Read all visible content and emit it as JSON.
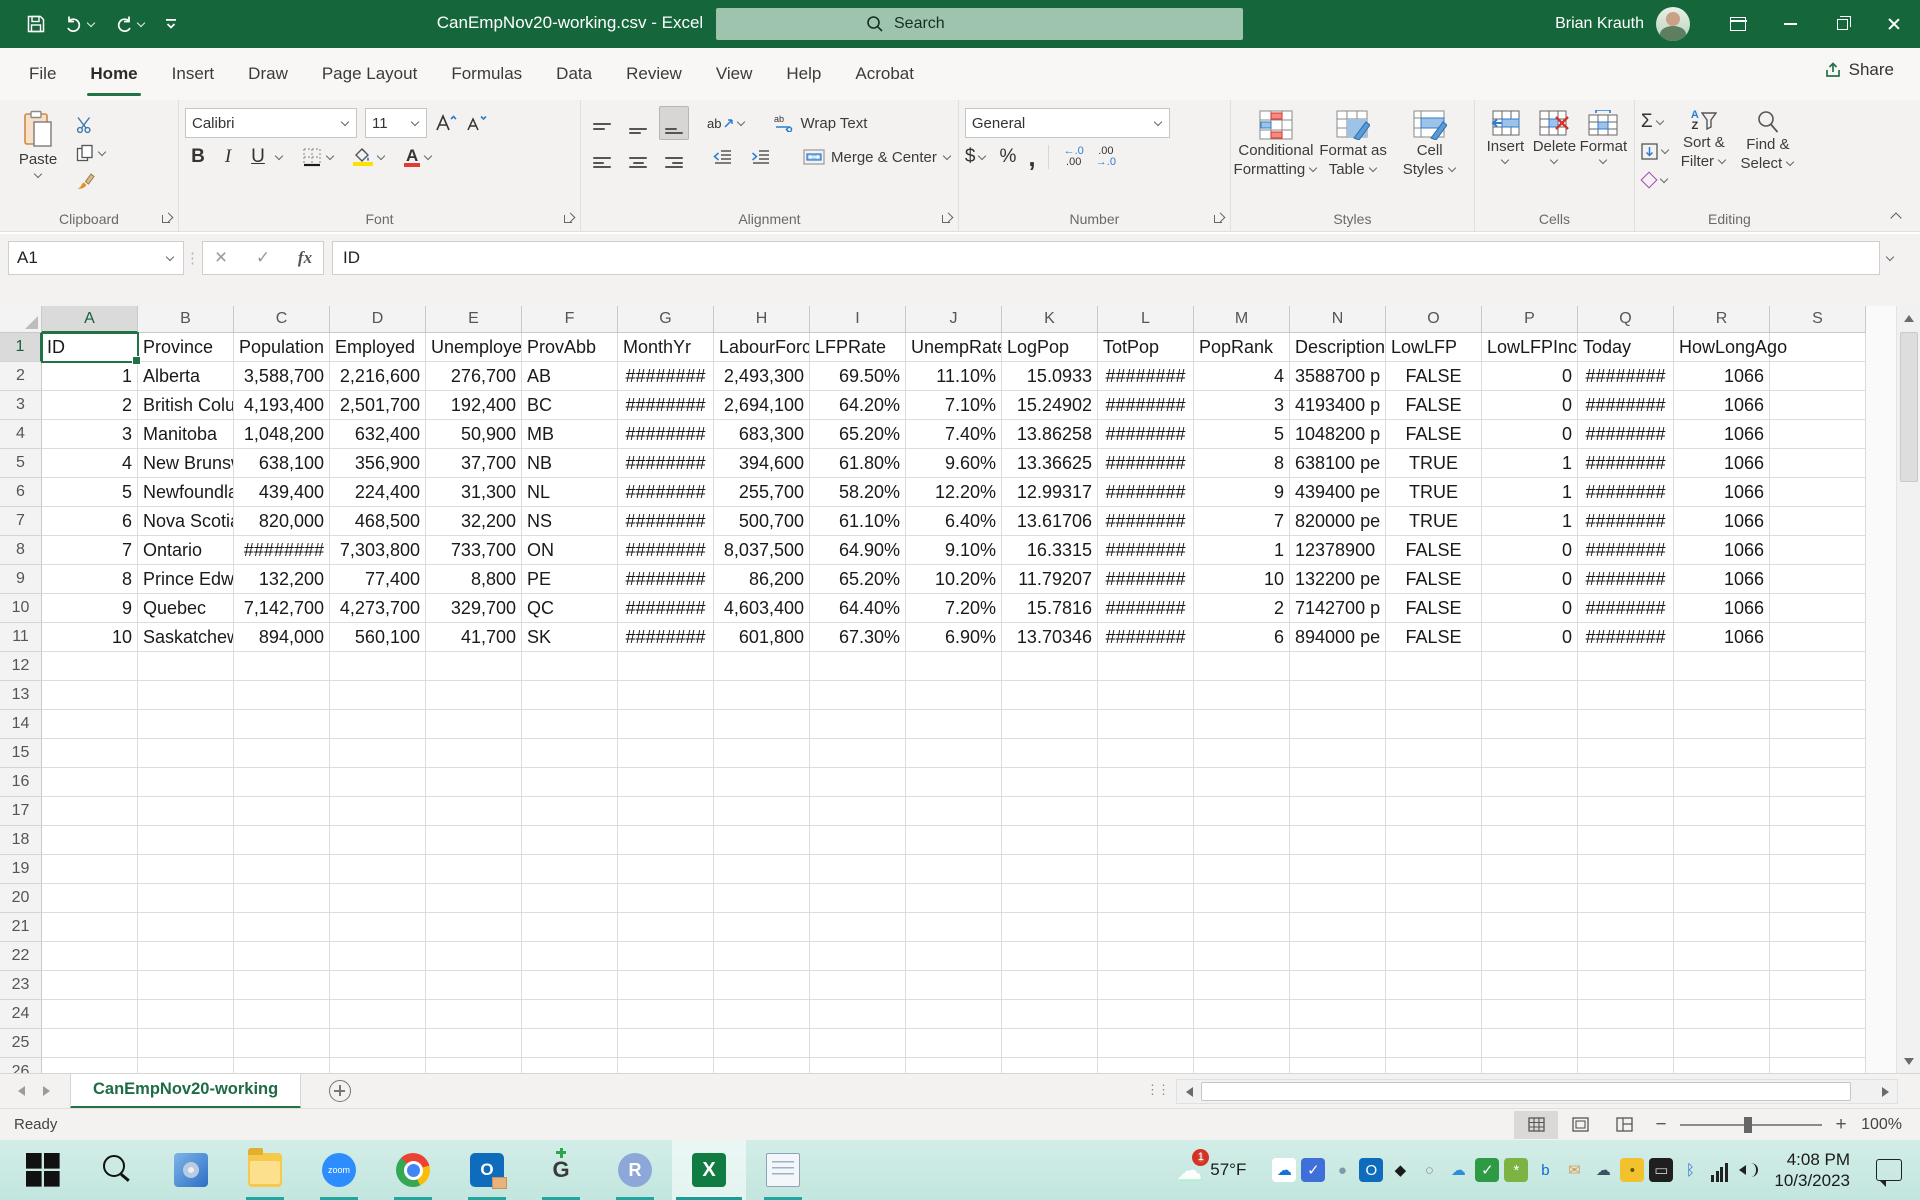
{
  "colors": {
    "excel_green": "#217346",
    "title_green": "#16663C",
    "taskbar_teal": "#20A8A0"
  },
  "titlebar": {
    "title": "CanEmpNov20-working.csv  -  Excel",
    "search_placeholder": "Search",
    "user_name": "Brian Krauth"
  },
  "ribbon": {
    "tabs": [
      "File",
      "Home",
      "Insert",
      "Draw",
      "Page Layout",
      "Formulas",
      "Data",
      "Review",
      "View",
      "Help",
      "Acrobat"
    ],
    "active_tab": "Home",
    "share_label": "Share",
    "groups": {
      "clipboard": {
        "label": "Clipboard",
        "paste": "Paste"
      },
      "font": {
        "label": "Font",
        "font_name": "Calibri",
        "font_size": "11"
      },
      "alignment": {
        "label": "Alignment",
        "wrap_text": "Wrap Text",
        "merge_center": "Merge & Center"
      },
      "number": {
        "label": "Number",
        "format": "General"
      },
      "styles": {
        "label": "Styles",
        "conditional_1": "Conditional",
        "conditional_2": "Formatting",
        "format_table_1": "Format as",
        "format_table_2": "Table",
        "cell_styles_1": "Cell",
        "cell_styles_2": "Styles"
      },
      "cells": {
        "label": "Cells",
        "insert": "Insert",
        "delete": "Delete",
        "format": "Format"
      },
      "editing": {
        "label": "Editing",
        "sort_1": "Sort &",
        "sort_2": "Filter",
        "find_1": "Find &",
        "find_2": "Select"
      }
    }
  },
  "icons": {
    "bold": "B",
    "italic": "I",
    "underline": "U",
    "font_color": "A",
    "fill_color": "A",
    "autosum": "Σ",
    "currency": "$",
    "percent": "%",
    "comma": ",",
    "orientation": "ab",
    "wrap_ab": "ab",
    "dec_inc_top": "←.0",
    "dec_inc_bot": ".00",
    "dec_dec_top": ".00",
    "dec_dec_bot": "→.0",
    "fx": "fx",
    "cancel": "×",
    "enter": "✓",
    "az_a": "A",
    "az_z": "Z"
  },
  "formula_bar": {
    "name_box": "A1",
    "content": "ID"
  },
  "sheet": {
    "columns": [
      "A",
      "B",
      "C",
      "D",
      "E",
      "F",
      "G",
      "H",
      "I",
      "J",
      "K",
      "L",
      "M",
      "N",
      "O",
      "P",
      "Q",
      "R",
      "S"
    ],
    "selected_cell": "A1",
    "visible_rows": 26,
    "col_align": [
      "right",
      "left",
      "right",
      "right",
      "right",
      "left",
      "center",
      "right",
      "right",
      "right",
      "right",
      "center",
      "right",
      "left",
      "center",
      "right",
      "center",
      "right",
      "left"
    ],
    "header_row": [
      "ID",
      "Province",
      "Population",
      "Employed",
      "Unemployed",
      "ProvAbb",
      "MonthYr",
      "LabourForce",
      "LFPRate",
      "UnempRate",
      "LogPop",
      "TotPop",
      "PopRank",
      "Description",
      "LowLFP",
      "LowLFPInc",
      "Today",
      "HowLongAgo",
      ""
    ],
    "rows": [
      [
        "1",
        "Alberta",
        "3,588,700",
        "2,216,600",
        "276,700",
        "AB",
        "########",
        "2,493,300",
        "69.50%",
        "11.10%",
        "15.0933",
        "########",
        "4",
        "3588700 p",
        "FALSE",
        "0",
        "########",
        "1066",
        ""
      ],
      [
        "2",
        "British Columbia",
        "4,193,400",
        "2,501,700",
        "192,400",
        "BC",
        "########",
        "2,694,100",
        "64.20%",
        "7.10%",
        "15.24902",
        "########",
        "3",
        "4193400 p",
        "FALSE",
        "0",
        "########",
        "1066",
        ""
      ],
      [
        "3",
        "Manitoba",
        "1,048,200",
        "632,400",
        "50,900",
        "MB",
        "########",
        "683,300",
        "65.20%",
        "7.40%",
        "13.86258",
        "########",
        "5",
        "1048200 p",
        "FALSE",
        "0",
        "########",
        "1066",
        ""
      ],
      [
        "4",
        "New Brunswick",
        "638,100",
        "356,900",
        "37,700",
        "NB",
        "########",
        "394,600",
        "61.80%",
        "9.60%",
        "13.36625",
        "########",
        "8",
        "638100 pe",
        "TRUE",
        "1",
        "########",
        "1066",
        ""
      ],
      [
        "5",
        "Newfoundland",
        "439,400",
        "224,400",
        "31,300",
        "NL",
        "########",
        "255,700",
        "58.20%",
        "12.20%",
        "12.99317",
        "########",
        "9",
        "439400 pe",
        "TRUE",
        "1",
        "########",
        "1066",
        ""
      ],
      [
        "6",
        "Nova Scotia",
        "820,000",
        "468,500",
        "32,200",
        "NS",
        "########",
        "500,700",
        "61.10%",
        "6.40%",
        "13.61706",
        "########",
        "7",
        "820000 pe",
        "TRUE",
        "1",
        "########",
        "1066",
        ""
      ],
      [
        "7",
        "Ontario",
        "########",
        "7,303,800",
        "733,700",
        "ON",
        "########",
        "8,037,500",
        "64.90%",
        "9.10%",
        "16.3315",
        "########",
        "1",
        "12378900",
        "FALSE",
        "0",
        "########",
        "1066",
        ""
      ],
      [
        "8",
        "Prince Edward Island",
        "132,200",
        "77,400",
        "8,800",
        "PE",
        "########",
        "86,200",
        "65.20%",
        "10.20%",
        "11.79207",
        "########",
        "10",
        "132200 pe",
        "FALSE",
        "0",
        "########",
        "1066",
        ""
      ],
      [
        "9",
        "Quebec",
        "7,142,700",
        "4,273,700",
        "329,700",
        "QC",
        "########",
        "4,603,400",
        "64.40%",
        "7.20%",
        "15.7816",
        "########",
        "2",
        "7142700 p",
        "FALSE",
        "0",
        "########",
        "1066",
        ""
      ],
      [
        "10",
        "Saskatchewan",
        "894,000",
        "560,100",
        "41,700",
        "SK",
        "########",
        "601,800",
        "67.30%",
        "6.90%",
        "13.70346",
        "########",
        "6",
        "894000 pe",
        "FALSE",
        "0",
        "########",
        "1066",
        ""
      ]
    ]
  },
  "tabs_bar": {
    "sheet_name": "CanEmpNov20-working"
  },
  "status_bar": {
    "status": "Ready",
    "zoom": "100%"
  },
  "taskbar": {
    "apps": [
      {
        "name": "start",
        "running": false
      },
      {
        "name": "search",
        "running": false
      },
      {
        "name": "media-player",
        "running": false
      },
      {
        "name": "file-explorer",
        "running": true
      },
      {
        "name": "zoom",
        "running": true,
        "glyph": "zoom"
      },
      {
        "name": "chrome",
        "running": true
      },
      {
        "name": "outlook",
        "running": true,
        "glyph": "O"
      },
      {
        "name": "github-desktop",
        "running": true,
        "glyph": "G"
      },
      {
        "name": "rstudio",
        "running": true,
        "glyph": "R"
      },
      {
        "name": "excel",
        "running": true,
        "active": true,
        "glyph": "X"
      },
      {
        "name": "notepad",
        "running": true
      }
    ],
    "weather": {
      "temp": "57°F",
      "badge": "1"
    },
    "tray": [
      {
        "name": "onedrive",
        "glyph": "☁",
        "color": "#1173d4",
        "bg": "#ffffff"
      },
      {
        "name": "antivirus-shield",
        "glyph": "✓",
        "color": "#ffffff",
        "bg": "#3f6fd8"
      },
      {
        "name": "privacy-drop",
        "glyph": "●",
        "color": "#7e97ad",
        "bg": "transparent"
      },
      {
        "name": "outlook-tray",
        "glyph": "O",
        "color": "#ffffff",
        "bg": "#0f6cbd"
      },
      {
        "name": "dropbox",
        "glyph": "◆",
        "color": "#1b1b1b",
        "bg": "transparent"
      },
      {
        "name": "vpn-ring",
        "glyph": "○",
        "color": "#8c9196",
        "bg": "transparent"
      },
      {
        "name": "cloud-sync",
        "glyph": "☁",
        "color": "#2a8fd8",
        "bg": "transparent"
      },
      {
        "name": "defender-shield",
        "glyph": "✓",
        "color": "#ffffff",
        "bg": "#2d9a44"
      },
      {
        "name": "photos",
        "glyph": "*",
        "color": "#ffffff",
        "bg": "#7cb342"
      },
      {
        "name": "bing",
        "glyph": "b",
        "color": "#0b69c7",
        "bg": "transparent"
      },
      {
        "name": "mail",
        "glyph": "✉",
        "color": "#dd9a55",
        "bg": "transparent"
      },
      {
        "name": "cloud-backup",
        "glyph": "☁",
        "color": "#3d5166",
        "bg": "transparent"
      },
      {
        "name": "hotspot",
        "glyph": "•",
        "color": "#6b5200",
        "bg": "#f2c12e"
      },
      {
        "name": "display-plug",
        "glyph": "▭",
        "color": "#cfcfcf",
        "bg": "#1f1f1f"
      },
      {
        "name": "bluetooth",
        "glyph": "ᛒ",
        "color": "#2a6fd4",
        "bg": "transparent"
      },
      {
        "name": "network",
        "cls": "ic-bars"
      },
      {
        "name": "volume",
        "cls": "ic-vol"
      }
    ],
    "time": "4:08 PM",
    "date": "10/3/2023"
  }
}
